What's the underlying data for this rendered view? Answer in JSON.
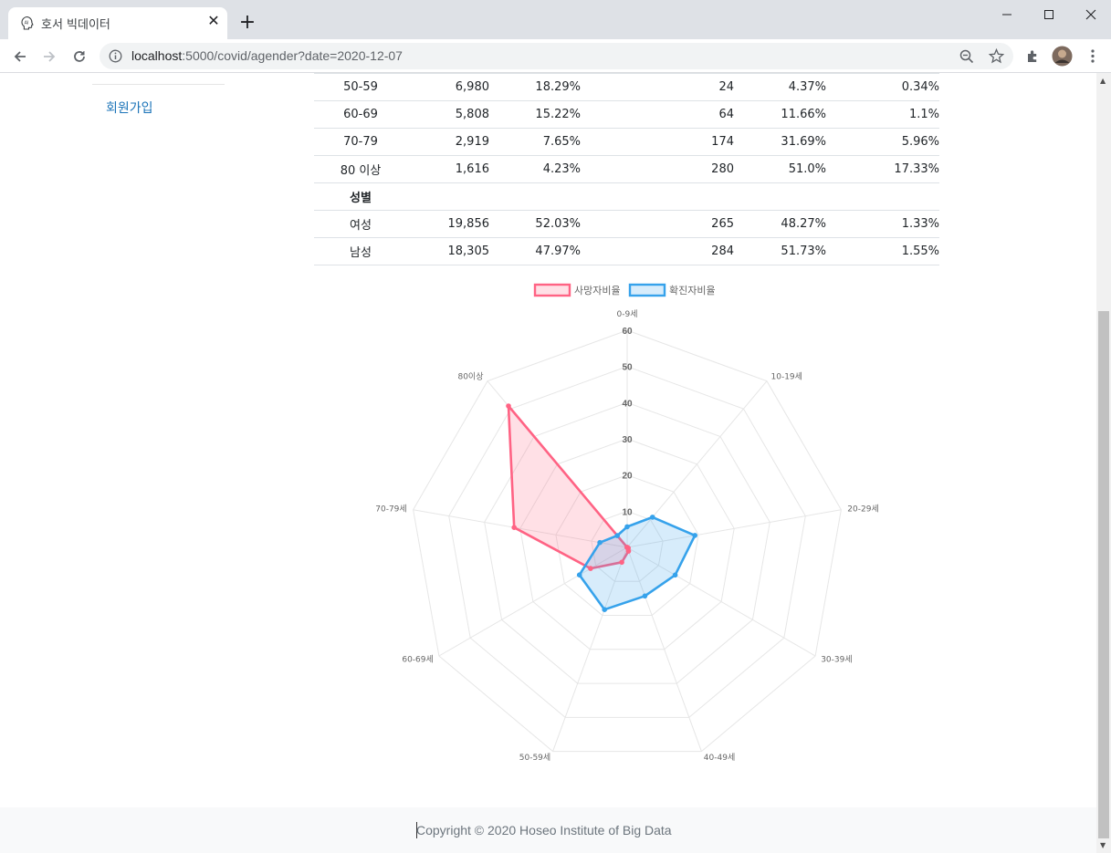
{
  "browser": {
    "tab_title": "호서 빅데이터",
    "favicon_text": "AI",
    "tab_close": "✕",
    "new_tab": "+",
    "url_host": "localhost",
    "url_rest": ":5000/covid/agender?date=2020-12-07"
  },
  "sidebar": {
    "signup_link": "회원가입"
  },
  "table": {
    "rows": [
      [
        "50-59",
        "6,980",
        "18.29%",
        "24",
        "4.37%",
        "0.34%"
      ],
      [
        "60-69",
        "5,808",
        "15.22%",
        "64",
        "11.66%",
        "1.1%"
      ],
      [
        "70-79",
        "2,919",
        "7.65%",
        "174",
        "31.69%",
        "5.96%"
      ],
      [
        "80 이상",
        "1,616",
        "4.23%",
        "280",
        "51.0%",
        "17.33%"
      ]
    ],
    "gender_header": "성별",
    "gender_rows": [
      [
        "여성",
        "19,856",
        "52.03%",
        "265",
        "48.27%",
        "1.33%"
      ],
      [
        "남성",
        "18,305",
        "47.97%",
        "284",
        "51.73%",
        "1.55%"
      ]
    ]
  },
  "chart_data": {
    "type": "radar",
    "categories": [
      "0-9세",
      "10-19세",
      "20-29세",
      "30-39세",
      "40-49세",
      "50-59세",
      "60-69세",
      "70-79세",
      "80이상"
    ],
    "series": [
      {
        "name": "사망자비율",
        "values": [
          0.0,
          0.0,
          0.0,
          0.36,
          1.09,
          4.37,
          11.66,
          31.69,
          51.0
        ],
        "color": "#ff6384"
      },
      {
        "name": "확진자비율",
        "values": [
          5.7,
          10.9,
          19.0,
          15.3,
          14.3,
          18.29,
          15.22,
          7.65,
          4.23
        ],
        "color": "#36a2eb"
      }
    ],
    "r_ticks": [
      10,
      20,
      30,
      40,
      50,
      60
    ],
    "r_range": [
      0,
      60
    ],
    "legend_position": "top",
    "grid": true
  },
  "footer": {
    "copyright": "Copyright © 2020 Hoseo Institute of Big Data"
  },
  "colors": {
    "link": "#1a73b8",
    "footer_bg": "#f8f9fa"
  }
}
